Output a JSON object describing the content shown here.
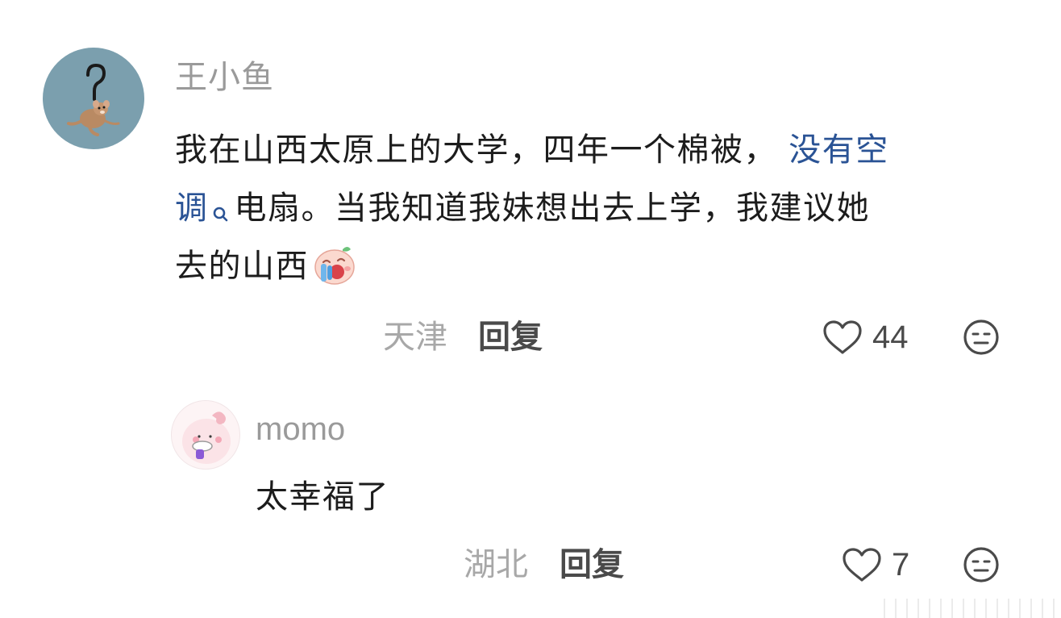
{
  "comment": {
    "username": "王小鱼",
    "text_lines": [
      "我在山西太原上的大学，四年一个棉被，",
      "电扇。当我知道我妹想出去上学，我建议她",
      "去的山西"
    ],
    "keyword_part1": "没有空",
    "keyword_part2": "调",
    "location": "天津",
    "reply_label": "回复",
    "like_count": "44",
    "avatar_icon": "question-mark-mouse-avatar",
    "emoji_icon": "crying-face-emoji",
    "link_color": "#2a5395"
  },
  "reply": {
    "username": "momo",
    "text": "太幸福了",
    "location": "湖北",
    "reply_label": "回复",
    "like_count": "7",
    "avatar_icon": "pink-cartoon-avatar"
  },
  "icons": {
    "like": "heart-outline-icon",
    "react": "neutral-face-icon",
    "search": "search-icon"
  }
}
